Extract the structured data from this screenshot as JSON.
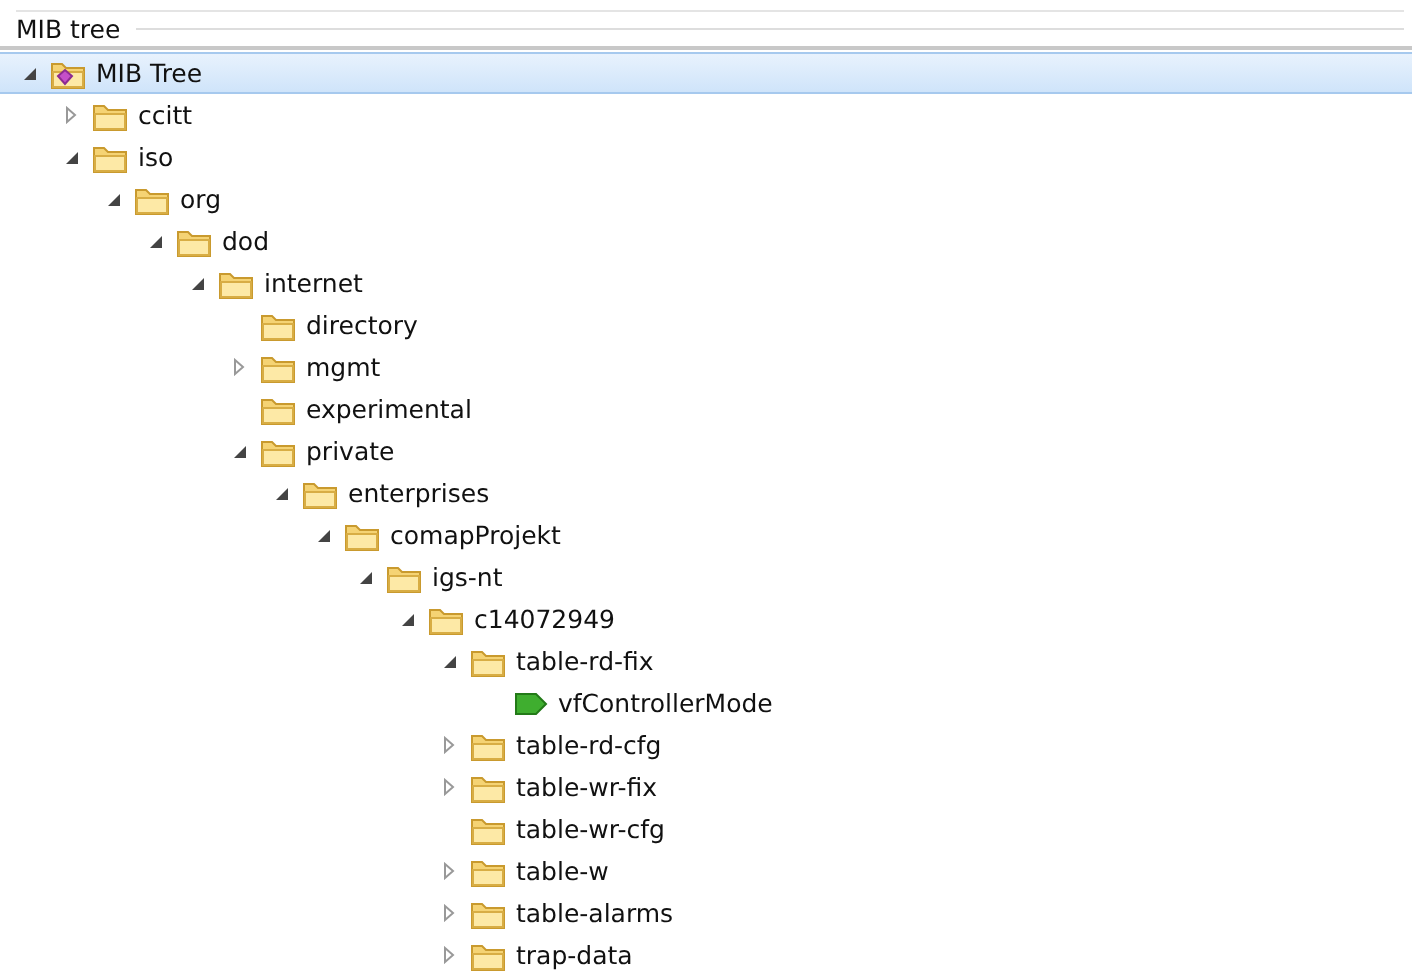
{
  "panel": {
    "title": "MIB tree"
  },
  "tree": [
    {
      "label": "MIB Tree",
      "kind": "root",
      "selected": true,
      "expanded": true,
      "children": [
        {
          "label": "ccitt",
          "kind": "folder",
          "selected": false,
          "expanded": false
        },
        {
          "label": "iso",
          "kind": "folder",
          "selected": false,
          "expanded": true,
          "children": [
            {
              "label": "org",
              "kind": "folder",
              "selected": false,
              "expanded": true,
              "children": [
                {
                  "label": "dod",
                  "kind": "folder",
                  "selected": false,
                  "expanded": true,
                  "children": [
                    {
                      "label": "internet",
                      "kind": "folder",
                      "selected": false,
                      "expanded": true,
                      "children": [
                        {
                          "label": "directory",
                          "kind": "folder",
                          "selected": false
                        },
                        {
                          "label": "mgmt",
                          "kind": "folder",
                          "selected": false,
                          "expanded": false
                        },
                        {
                          "label": "experimental",
                          "kind": "folder",
                          "selected": false
                        },
                        {
                          "label": "private",
                          "kind": "folder",
                          "selected": false,
                          "expanded": true,
                          "children": [
                            {
                              "label": "enterprises",
                              "kind": "folder",
                              "selected": false,
                              "expanded": true,
                              "children": [
                                {
                                  "label": "comapProjekt",
                                  "kind": "folder",
                                  "selected": false,
                                  "expanded": true,
                                  "children": [
                                    {
                                      "label": "igs-nt",
                                      "kind": "folder",
                                      "selected": false,
                                      "expanded": true,
                                      "children": [
                                        {
                                          "label": "c14072949",
                                          "kind": "folder",
                                          "selected": false,
                                          "expanded": true,
                                          "children": [
                                            {
                                              "label": "table-rd-fix",
                                              "kind": "folder",
                                              "selected": false,
                                              "expanded": true,
                                              "children": [
                                                {
                                                  "label": "vfControllerMode",
                                                  "kind": "leaf",
                                                  "selected": false
                                                }
                                              ]
                                            },
                                            {
                                              "label": "table-rd-cfg",
                                              "kind": "folder",
                                              "selected": false,
                                              "expanded": false
                                            },
                                            {
                                              "label": "table-wr-fix",
                                              "kind": "folder",
                                              "selected": false,
                                              "expanded": false
                                            },
                                            {
                                              "label": "table-wr-cfg",
                                              "kind": "folder",
                                              "selected": false
                                            },
                                            {
                                              "label": "table-w",
                                              "kind": "folder",
                                              "selected": false,
                                              "expanded": false
                                            },
                                            {
                                              "label": "table-alarms",
                                              "kind": "folder",
                                              "selected": false,
                                              "expanded": false
                                            },
                                            {
                                              "label": "trap-data",
                                              "kind": "folder",
                                              "selected": false,
                                              "expanded": false
                                            }
                                          ]
                                        }
                                      ]
                                    }
                                  ]
                                }
                              ]
                            }
                          ]
                        }
                      ]
                    }
                  ]
                }
              ]
            }
          ]
        }
      ]
    }
  ]
}
